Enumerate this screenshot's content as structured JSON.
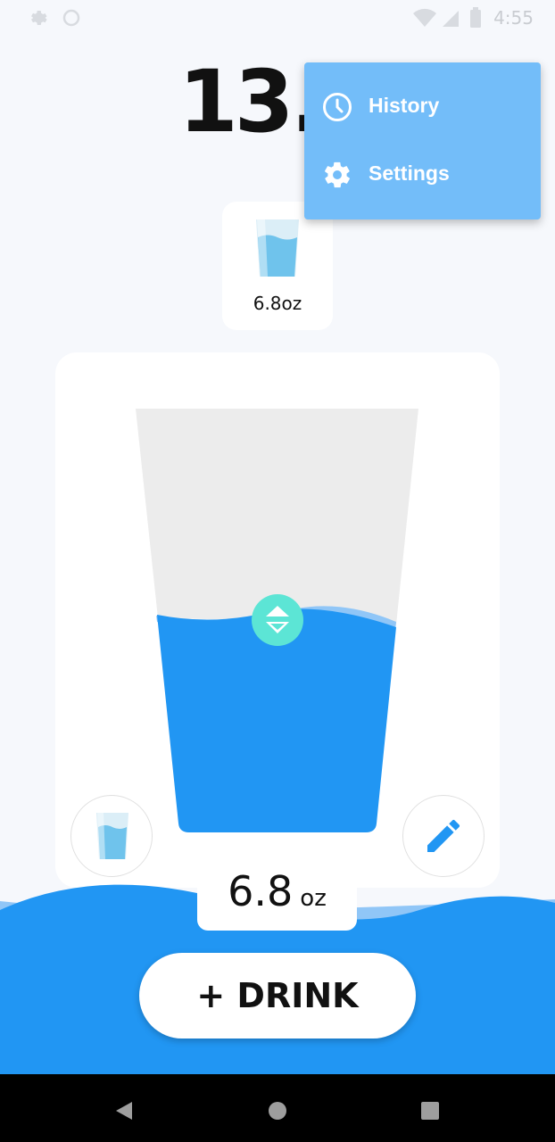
{
  "status_bar": {
    "time": "4:55"
  },
  "today": {
    "total": "13.5"
  },
  "selected_cup": {
    "label": "6.8oz"
  },
  "amount": {
    "value": "6.8",
    "unit": "oz"
  },
  "drink_button": {
    "label": "+ DRINK"
  },
  "overflow_menu": {
    "items": [
      {
        "label": "History",
        "icon": "clock-icon"
      },
      {
        "label": "Settings",
        "icon": "gear-icon"
      }
    ]
  },
  "colors": {
    "water": "#2196f3",
    "menu_bg": "#73bdf9",
    "handle": "#5ce5d5"
  }
}
